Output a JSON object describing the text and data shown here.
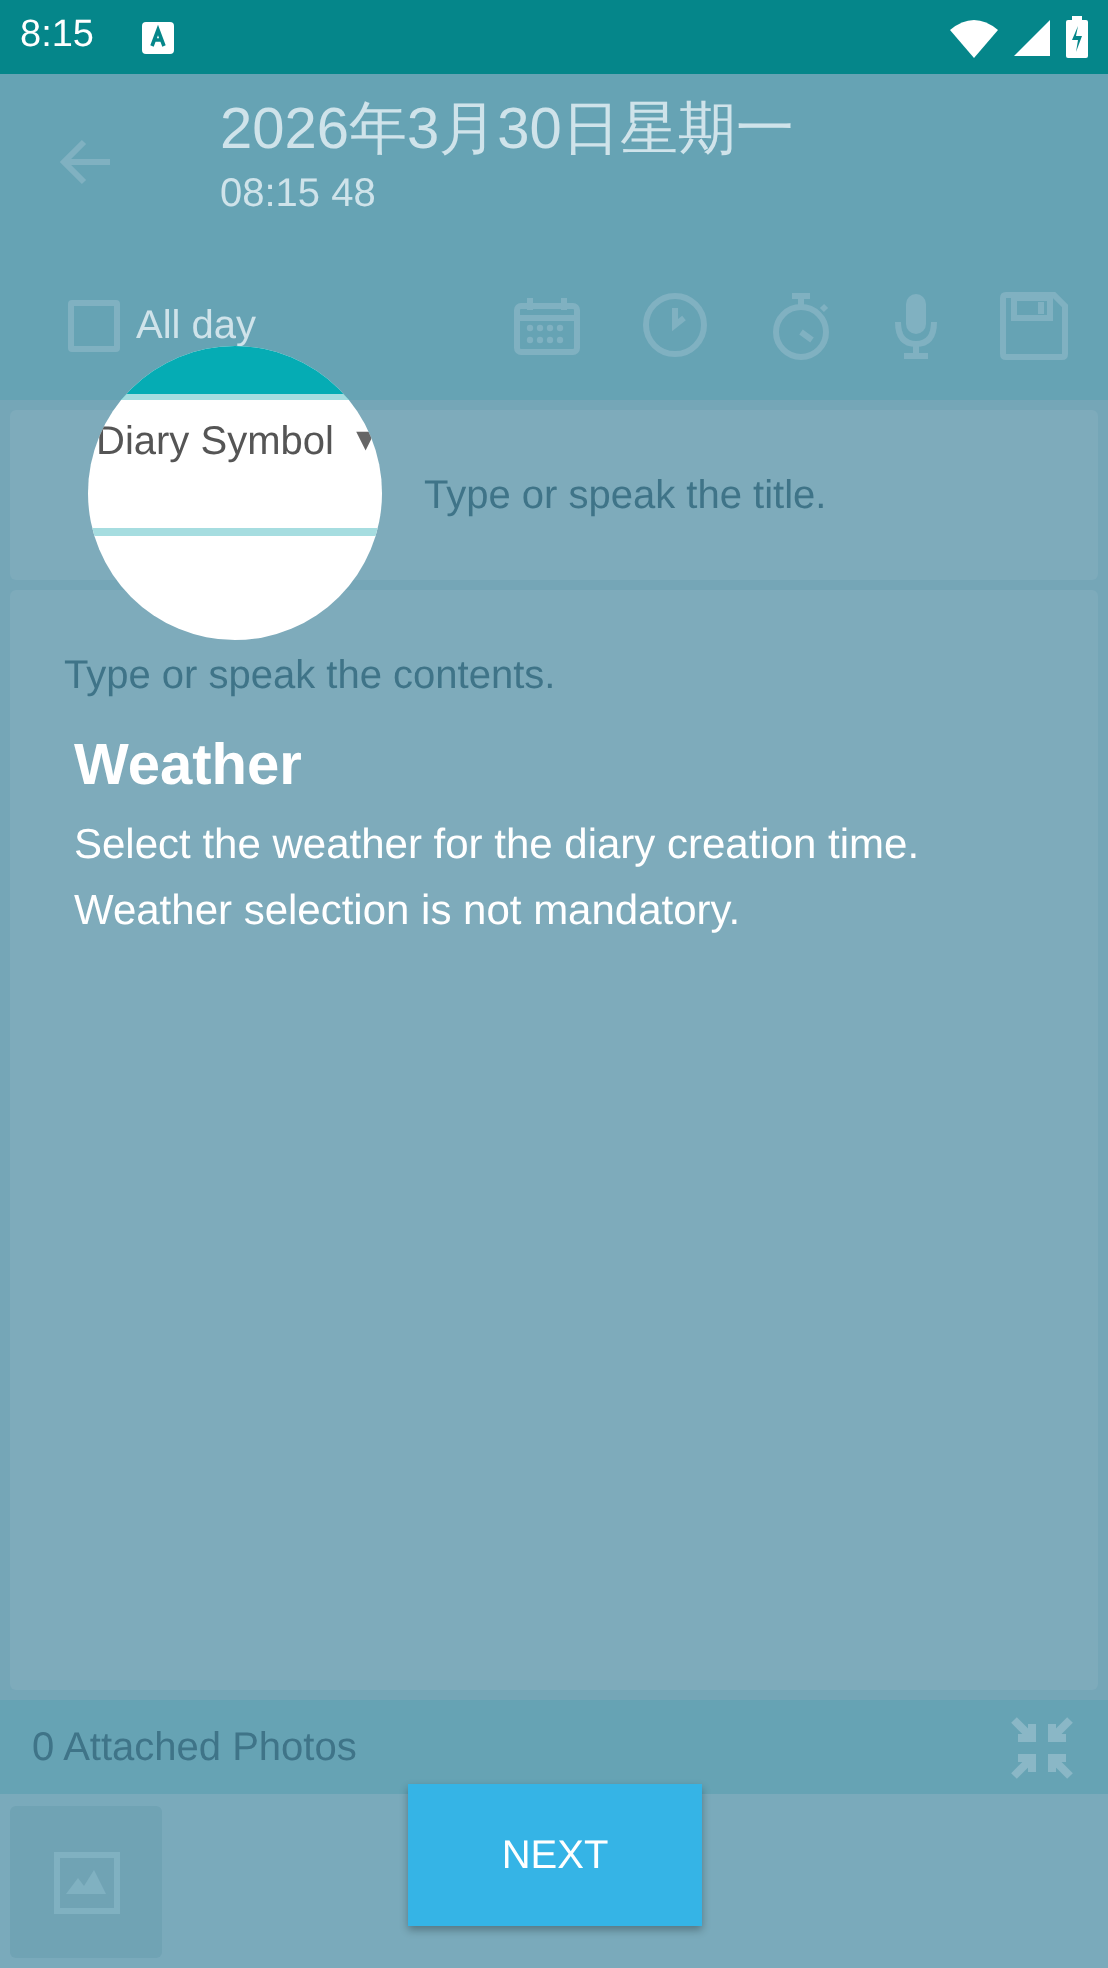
{
  "status_bar": {
    "time": "8:15"
  },
  "header": {
    "date": "2026年3月30日星期一",
    "time": "08:15 48"
  },
  "all_day": {
    "label": "All day",
    "checked": false
  },
  "symbol_dropdown": {
    "label": "Diary Symbol",
    "caret": "▼"
  },
  "title_field": {
    "placeholder": "Type or speak the title."
  },
  "contents_field": {
    "placeholder": "Type or speak the contents."
  },
  "attachments": {
    "label": "0 Attached Photos"
  },
  "tutorial": {
    "title": "Weather",
    "text": "Select the weather for the diary creation time. Weather selection is not mandatory.",
    "button": "NEXT"
  }
}
